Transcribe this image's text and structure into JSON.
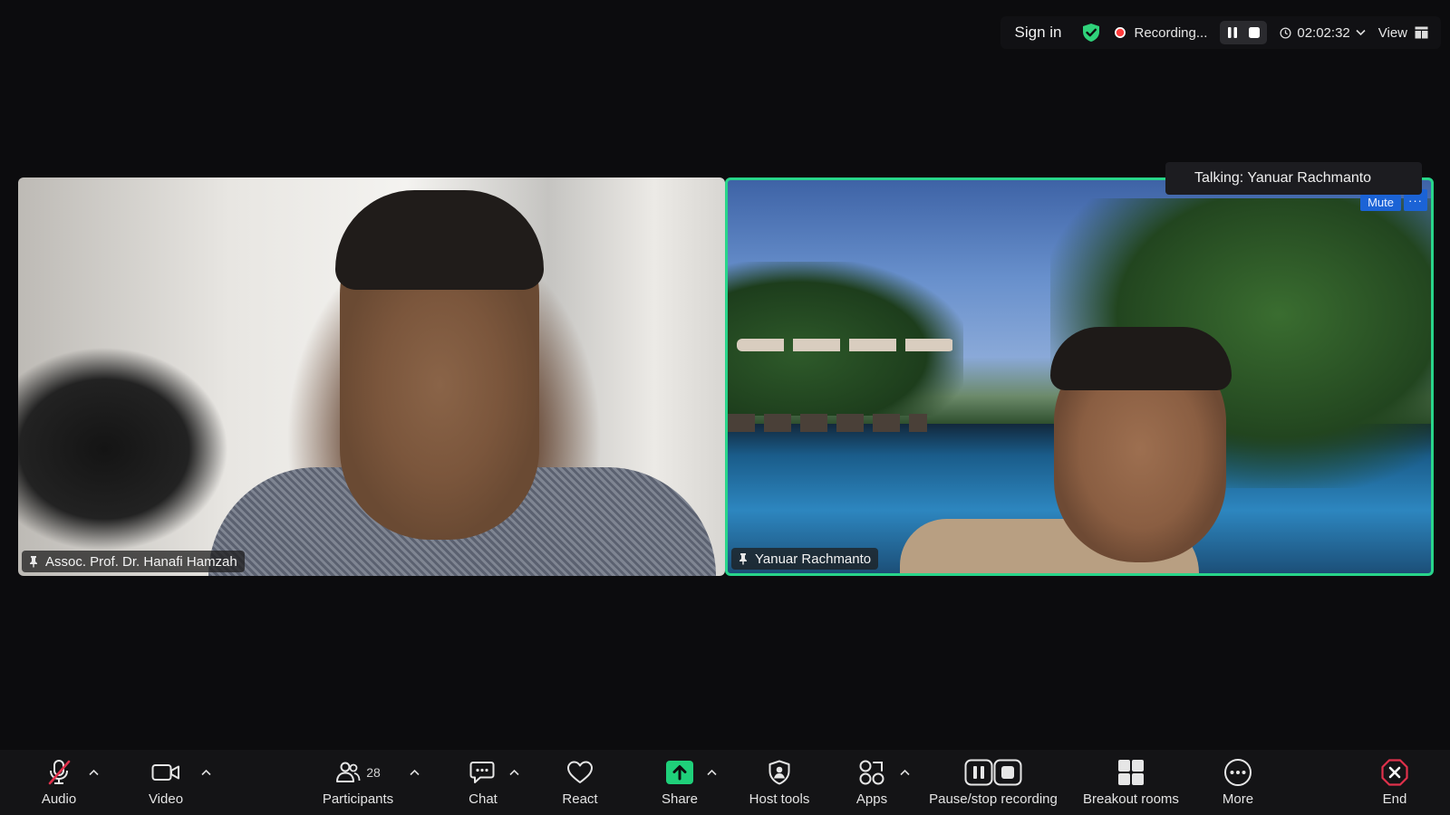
{
  "topbar": {
    "sign_in": "Sign in",
    "recording_label": "Recording...",
    "timer": "02:02:32",
    "view_label": "View",
    "shield_color": "#2fd27a",
    "rec_color": "#ff3b3b"
  },
  "talking": "Talking: Yanuar Rachmanto",
  "tiles": {
    "left": {
      "name": "Assoc. Prof. Dr. Hanafi Hamzah"
    },
    "right": {
      "name": "Yanuar Rachmanto",
      "mute_label": "Mute",
      "more_label": "···",
      "active_border": "#28d58a"
    }
  },
  "toolbar": {
    "audio": "Audio",
    "video": "Video",
    "participants": "Participants",
    "participants_count": "28",
    "chat": "Chat",
    "react": "React",
    "share": "Share",
    "host_tools": "Host tools",
    "apps": "Apps",
    "pause_stop": "Pause/stop recording",
    "breakout": "Breakout rooms",
    "more": "More",
    "end": "End",
    "share_color": "#1fd07a",
    "end_color": "#e0314b"
  }
}
